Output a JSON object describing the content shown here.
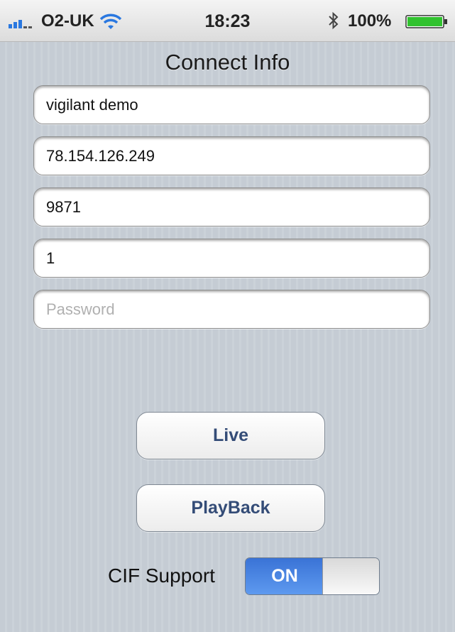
{
  "status_bar": {
    "carrier": "O2-UK",
    "time": "18:23",
    "battery_percent": "100%",
    "battery_level": 1.0,
    "icons": [
      "signal-icon",
      "wifi-icon",
      "bluetooth-icon",
      "battery-icon"
    ]
  },
  "title": "Connect Info",
  "fields": {
    "name": {
      "value": "vigilant demo"
    },
    "address": {
      "value": "78.154.126.249"
    },
    "port": {
      "value": "9871"
    },
    "channel": {
      "value": "1"
    },
    "password": {
      "value": "",
      "placeholder": "Password"
    }
  },
  "buttons": {
    "live": "Live",
    "playback": "PlayBack"
  },
  "cif": {
    "label": "CIF Support",
    "toggle_label": "ON",
    "enabled": true
  },
  "colors": {
    "toggle_on": "#3a73d6",
    "button_text": "#344c77",
    "background": "#c5ccd4"
  }
}
